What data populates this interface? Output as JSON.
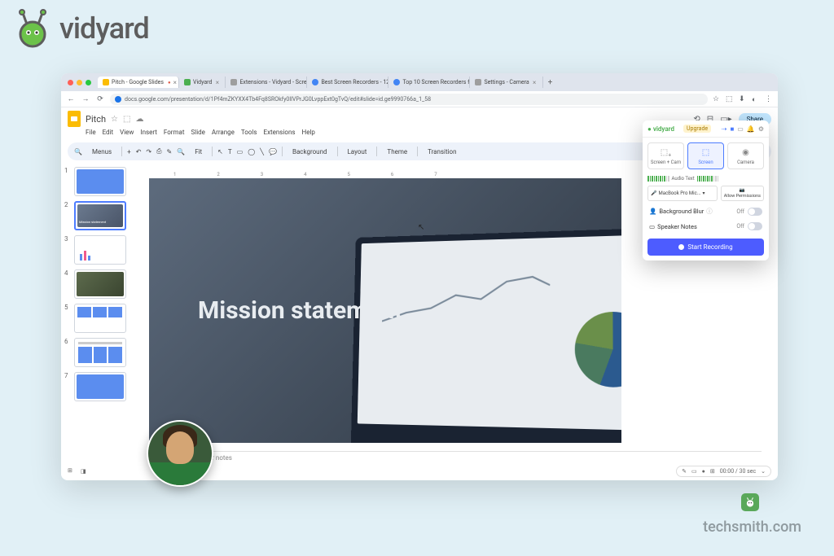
{
  "logo": {
    "text": "vidyard"
  },
  "watermark": "techsmith.com",
  "browser": {
    "tabs": [
      {
        "label": "Pitch - Google Slides"
      },
      {
        "label": "Vidyard"
      },
      {
        "label": "Extensions - Vidyard - Scre..."
      },
      {
        "label": "Best Screen Recorders - 12..."
      },
      {
        "label": "Top 10 Screen Recorders fo..."
      },
      {
        "label": "Settings - Camera"
      }
    ],
    "url": "docs.google.com/presentation/d/1Pf4mZKYXX4Tb4Fq8SROkfy0lIVPrJG0LvppExt0gTvQ/edit#slide=id.ge9990766a_1_58"
  },
  "slides": {
    "doc_title": "Pitch",
    "menu": [
      "File",
      "Edit",
      "View",
      "Insert",
      "Format",
      "Slide",
      "Arrange",
      "Tools",
      "Extensions",
      "Help"
    ],
    "toolbar": {
      "menus_btn": "Menus",
      "fit": "Fit",
      "background": "Background",
      "layout": "Layout",
      "theme": "Theme",
      "transition": "Transition"
    },
    "share": "Share",
    "thumb_count": 7,
    "slide_title": "Mission statement",
    "notes_placeholder": "Click to add speaker notes",
    "timer": "00:00 / 30 sec"
  },
  "ext": {
    "brand": "vidyard",
    "upgrade": "Upgrade",
    "modes": [
      {
        "label": "Screen + Cam"
      },
      {
        "label": "Screen"
      },
      {
        "label": "Camera"
      }
    ],
    "active_mode": 1,
    "audio_label": "Audio Text",
    "device": "MacBook Pro Mic...",
    "permissions": "Allow Permissions",
    "toggles": [
      {
        "label": "Background Blur",
        "state": "Off",
        "info": true
      },
      {
        "label": "Speaker Notes",
        "state": "Off",
        "info": false
      }
    ],
    "record": "Start Recording"
  }
}
